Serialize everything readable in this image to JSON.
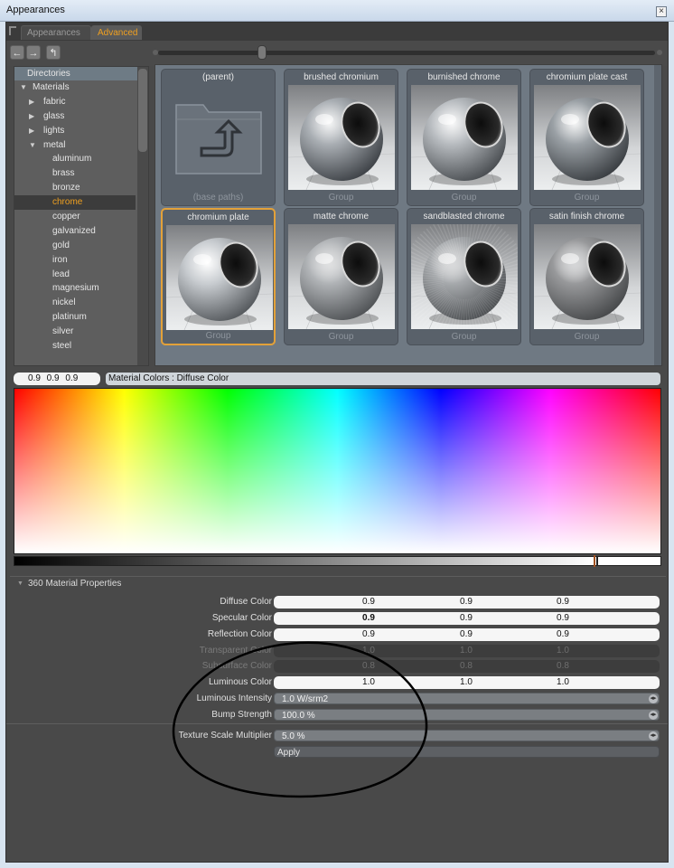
{
  "window": {
    "title": "Appearances",
    "close_symbol": "×"
  },
  "tabs": [
    {
      "label": "Appearances",
      "active": false
    },
    {
      "label": "Advanced",
      "active": true
    }
  ],
  "toolbar": {
    "back_icon": "arrow-left-icon",
    "forward_icon": "arrow-right-icon",
    "up_icon": "parent-folder-icon",
    "back_glyph": "←",
    "forward_glyph": "→",
    "up_glyph": "↰"
  },
  "directories": {
    "header": "Directories",
    "items": [
      {
        "label": "Materials",
        "level": 0,
        "arrow": "▼",
        "selected": false
      },
      {
        "label": "fabric",
        "level": 1,
        "arrow": "▶",
        "selected": false
      },
      {
        "label": "glass",
        "level": 1,
        "arrow": "▶",
        "selected": false
      },
      {
        "label": "lights",
        "level": 1,
        "arrow": "▶",
        "selected": false
      },
      {
        "label": "metal",
        "level": 1,
        "arrow": "▼",
        "selected": false
      },
      {
        "label": "aluminum",
        "level": 2,
        "arrow": "",
        "selected": false
      },
      {
        "label": "brass",
        "level": 2,
        "arrow": "",
        "selected": false
      },
      {
        "label": "bronze",
        "level": 2,
        "arrow": "",
        "selected": false
      },
      {
        "label": "chrome",
        "level": 2,
        "arrow": "",
        "selected": true
      },
      {
        "label": "copper",
        "level": 2,
        "arrow": "",
        "selected": false
      },
      {
        "label": "galvanized",
        "level": 2,
        "arrow": "",
        "selected": false
      },
      {
        "label": "gold",
        "level": 2,
        "arrow": "",
        "selected": false
      },
      {
        "label": "iron",
        "level": 2,
        "arrow": "",
        "selected": false
      },
      {
        "label": "lead",
        "level": 2,
        "arrow": "",
        "selected": false
      },
      {
        "label": "magnesium",
        "level": 2,
        "arrow": "",
        "selected": false
      },
      {
        "label": "nickel",
        "level": 2,
        "arrow": "",
        "selected": false
      },
      {
        "label": "platinum",
        "level": 2,
        "arrow": "",
        "selected": false
      },
      {
        "label": "silver",
        "level": 2,
        "arrow": "",
        "selected": false
      },
      {
        "label": "steel",
        "level": 2,
        "arrow": "",
        "selected": false
      }
    ]
  },
  "materials": [
    {
      "name": "(parent)",
      "label": "(base paths)",
      "kind": "folder",
      "selected": false
    },
    {
      "name": "brushed chromium",
      "label": "Group",
      "kind": "sphere",
      "finish": "brushed",
      "selected": false
    },
    {
      "name": "burnished chrome",
      "label": "Group",
      "kind": "sphere",
      "finish": "burnished",
      "selected": false
    },
    {
      "name": "chromium plate cast",
      "label": "Group",
      "kind": "sphere",
      "finish": "cast",
      "selected": false
    },
    {
      "name": "chromium plate",
      "label": "Group",
      "kind": "sphere",
      "finish": "mirror",
      "selected": true
    },
    {
      "name": "matte chrome",
      "label": "Group",
      "kind": "sphere",
      "finish": "matte",
      "selected": false
    },
    {
      "name": "sandblasted chrome",
      "label": "Group",
      "kind": "sphere",
      "finish": "sandblasted",
      "selected": false
    },
    {
      "name": "satin finish chrome",
      "label": "Group",
      "kind": "sphere",
      "finish": "satin",
      "selected": false
    }
  ],
  "color_picker": {
    "values_text": "0.9 0.9 0.9",
    "label": "Material Colors : Diffuse Color"
  },
  "properties": {
    "header": "360 Material Properties",
    "rows": [
      {
        "label": "Diffuse Color",
        "values": [
          "0.9",
          "0.9",
          "0.9"
        ],
        "enabled": true,
        "bold_first": false
      },
      {
        "label": "Specular Color",
        "values": [
          "0.9",
          "0.9",
          "0.9"
        ],
        "enabled": true,
        "bold_first": true
      },
      {
        "label": "Reflection Color",
        "values": [
          "0.9",
          "0.9",
          "0.9"
        ],
        "enabled": true,
        "bold_first": false
      },
      {
        "label": "Transparent Color",
        "values": [
          "1.0",
          "1.0",
          "1.0"
        ],
        "enabled": false,
        "bold_first": false
      },
      {
        "label": "Subsurface Color",
        "values": [
          "0.8",
          "0.8",
          "0.8"
        ],
        "enabled": false,
        "bold_first": false
      },
      {
        "label": "Luminous Color",
        "values": [
          "1.0",
          "1.0",
          "1.0"
        ],
        "enabled": true,
        "bold_first": false
      }
    ],
    "luminous_intensity": {
      "label": "Luminous Intensity",
      "value": "1.0 W/srm2"
    },
    "bump_strength": {
      "label": "Bump Strength",
      "value": "100.0 %"
    },
    "texture_scale": {
      "label": "Texture Scale Multiplier",
      "value": "5.0 %"
    },
    "apply_label": "Apply"
  }
}
